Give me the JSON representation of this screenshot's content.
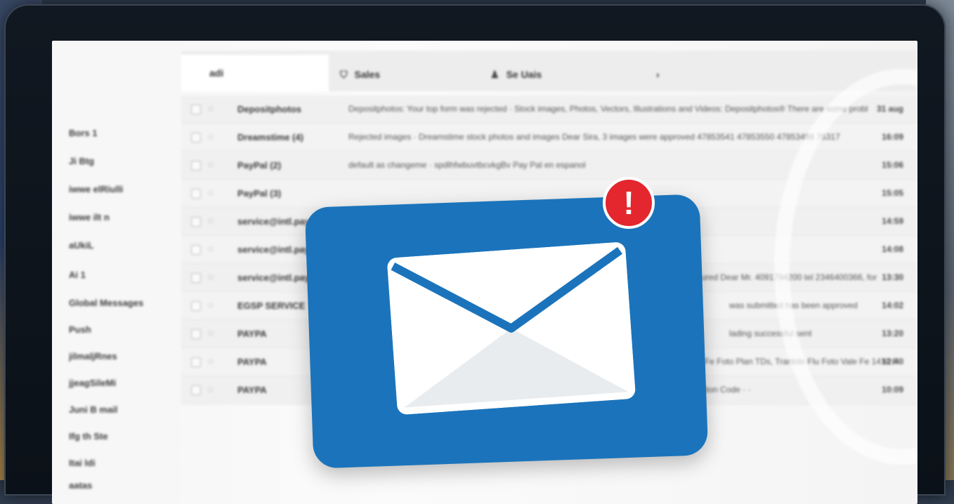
{
  "sidebar": {
    "items": [
      "Bors 1",
      "Ji Btg",
      "iwwe elRiulli",
      "iwwe ilt n",
      "aUkiL",
      "Ai 1",
      "Global Messages",
      "Push",
      "jilmaljRnes",
      "jjeagSileMi",
      "Juni B mail",
      "Ifg th Ste",
      "Itai ldi",
      "aatas"
    ]
  },
  "tabs": [
    {
      "label": "adi",
      "icon": ""
    },
    {
      "label": "Sales",
      "icon": "tag-icon"
    },
    {
      "label": "Se Uais",
      "icon": "person-icon"
    },
    {
      "label": "›",
      "icon": ""
    }
  ],
  "inbox": {
    "rows": [
      {
        "sender": "Depositphotos",
        "subject": "Depositphotos: Your top form was rejected · Stock images, Photos, Vectors, Illustrations and Videos: Depositphotos® There are some problems with your",
        "time": "31 aug"
      },
      {
        "sender": "Dreamstime (4)",
        "subject": "Rejected images · Dreamstime stock photos and images Dear Sira, 3 images were approved 47853541 47853550 47853498 75317",
        "time": "16:09"
      },
      {
        "sender": "PayPal (2)",
        "subject": "default as changeme · spdlhfwbuvtbcvkgBv Pay Pal en espanol",
        "time": "15:06"
      },
      {
        "sender": "PayPal (3)",
        "subject": "",
        "time": "15:05"
      },
      {
        "sender": "service@intl.paypal",
        "subject": "",
        "time": "14:59"
      },
      {
        "sender": "service@intl.paypal",
        "subject": "",
        "time": "14:08"
      },
      {
        "sender": "service@intl.paypal",
        "subject": "ured Dear Mr. 4091794200 tel 2346400366, for",
        "time": "13:30"
      },
      {
        "sender": "EGSP SERVICE",
        "subject": "was submitted has been approved",
        "time": "14:02"
      },
      {
        "sender": "PAYPA",
        "subject": "lading successful sent",
        "time": "13:20"
      },
      {
        "sender": "PAYPA",
        "subject": "Tim Ebenderen Fe Foto Plan TDs, Trankite Flu Foto Vale Fe 1410 FI",
        "time": "12:40"
      },
      {
        "sender": "PAYPA",
        "subject": "You've got a 5 dollar discount coupon · Pictofo You've got a 5 dollar discount coupon Promotion Code · ·",
        "time": "10:09"
      }
    ]
  },
  "icons": {
    "envelope": "envelope-icon",
    "alert": "exclamation-icon"
  },
  "badge": {
    "symbol": "!"
  },
  "colors": {
    "envelope_card": "#1b74bb",
    "badge": "#e4262e",
    "screen": "#f6f6f6",
    "bezel": "#111821"
  }
}
